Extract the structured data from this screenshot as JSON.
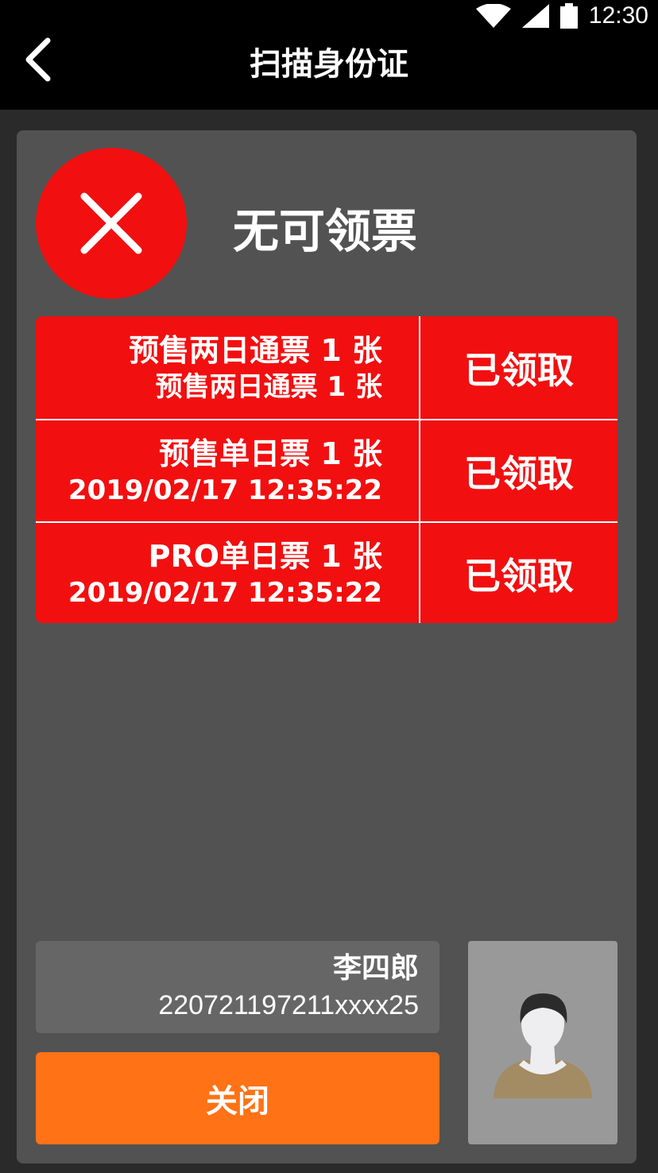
{
  "statusbar": {
    "time": "12:30",
    "icons": [
      "wifi-icon",
      "signal-icon",
      "battery-icon"
    ]
  },
  "appbar": {
    "title": "扫描身份证",
    "back_icon": "chevron-left-icon"
  },
  "result": {
    "icon": "close-icon",
    "text": "无可领票",
    "color": "#f20f10"
  },
  "tickets": [
    {
      "name": "预售两日通票 1 张",
      "sub": "预售两日通票 1 张",
      "status": "已领取"
    },
    {
      "name": "预售单日票 1 张",
      "sub": "2019/02/17 12:35:22",
      "status": "已领取"
    },
    {
      "name": "PRO单日票 1 张",
      "sub": "2019/02/17 12:35:22",
      "status": "已领取"
    }
  ],
  "person": {
    "name": "李四郎",
    "id_number": "220721197211xxxx25",
    "photo_icon": "avatar-icon"
  },
  "close_button": {
    "label": "关闭",
    "color": "#ff7215"
  }
}
